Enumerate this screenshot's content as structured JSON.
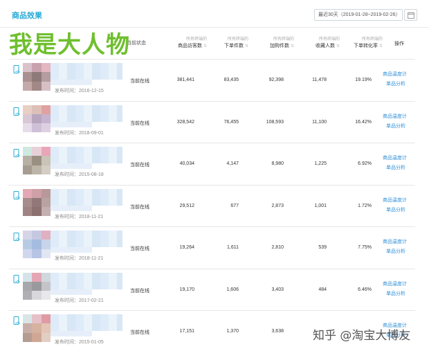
{
  "header": {
    "section_title": "商品效果",
    "date_range": "最近30天（2019-01-28~2019-02-26）"
  },
  "watermark": {
    "top": "我是大人物",
    "bottom": "知乎 @淘宝大博友"
  },
  "columns": {
    "status": "当前状态",
    "action": "操作",
    "metrics": [
      {
        "sub": "所有终端的",
        "main": "商品访客数"
      },
      {
        "sub": "所有终端的",
        "main": "下单件数"
      },
      {
        "sub": "所有终端的",
        "main": "加购件数"
      },
      {
        "sub": "所有终端的",
        "main": "收藏人数"
      },
      {
        "sub": "所有终端的",
        "main": "下单转化率"
      }
    ]
  },
  "rows": [
    {
      "publish": "发布时间：2016-12-15",
      "status": "当前在线",
      "visitors": "381,441",
      "orders": "83,435",
      "cart": "92,398",
      "fav": "11,478",
      "rate": "19.19%",
      "action1": "商品温度计",
      "action2": "单品分析"
    },
    {
      "publish": "发布时间：2018-09-01",
      "status": "当前在线",
      "visitors": "328,542",
      "orders": "76,455",
      "cart": "108,593",
      "fav": "11,100",
      "rate": "16.42%",
      "action1": "商品温度计",
      "action2": "单品分析"
    },
    {
      "publish": "发布时间：2015-08-18",
      "status": "当前在线",
      "visitors": "40,034",
      "orders": "4,147",
      "cart": "8,980",
      "fav": "1,225",
      "rate": "6.92%",
      "action1": "商品温度计",
      "action2": "单品分析"
    },
    {
      "publish": "发布时间：2018-11-21",
      "status": "当前在线",
      "visitors": "29,512",
      "orders": "677",
      "cart": "2,873",
      "fav": "1,001",
      "rate": "1.72%",
      "action1": "商品温度计",
      "action2": "单品分析"
    },
    {
      "publish": "发布时间：2018-11-21",
      "status": "当前在线",
      "visitors": "19,264",
      "orders": "1,611",
      "cart": "2,810",
      "fav": "539",
      "rate": "7.75%",
      "action1": "商品温度计",
      "action2": "单品分析"
    },
    {
      "publish": "发布时间：2017-02-21",
      "status": "当前在线",
      "visitors": "19,170",
      "orders": "1,606",
      "cart": "3,403",
      "fav": "484",
      "rate": "6.46%",
      "action1": "商品温度计",
      "action2": "单品分析"
    },
    {
      "publish": "发布时间：2015-01-05",
      "status": "当前在线",
      "visitors": "17,151",
      "orders": "1,370",
      "cart": "3,638",
      "fav": "",
      "rate": "",
      "action1": "商品温度计",
      "action2": "单品分析"
    }
  ],
  "colors": {
    "accent": "#26a9d6",
    "link": "#2e8fd8",
    "watermark": "#6fbf2e"
  }
}
